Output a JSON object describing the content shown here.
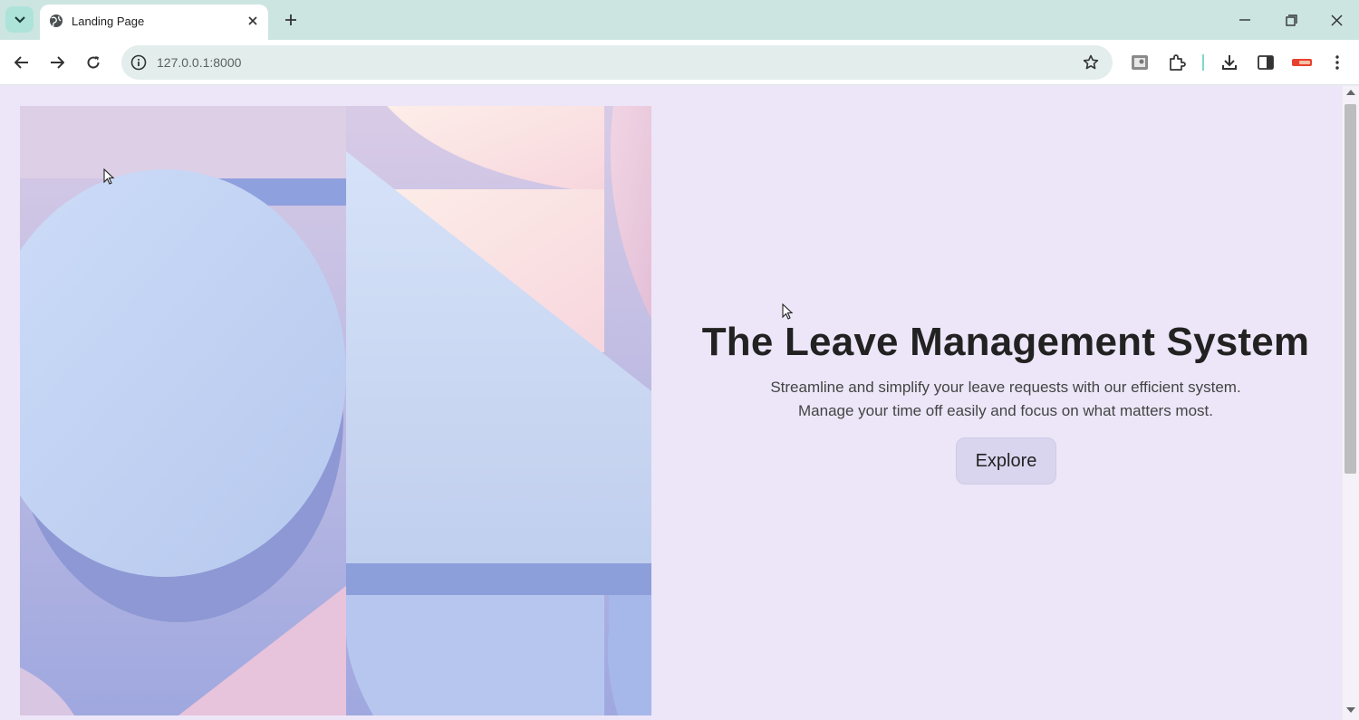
{
  "browser": {
    "tab": {
      "title": "Landing Page"
    },
    "address_bar": {
      "url": "127.0.0.1:8000"
    }
  },
  "page": {
    "title": "The Leave Management System",
    "description_line1": "Streamline and simplify your leave requests with our efficient system.",
    "description_line2": "Manage your time off easily and focus on what matters most.",
    "cta_label": "Explore"
  },
  "icons": {
    "tab_search": "chevron-down-icon",
    "favicon": "globe-icon",
    "tab_close": "close-icon",
    "new_tab": "plus-icon",
    "minimize": "minimize-icon",
    "restore": "restore-icon",
    "close_window": "close-icon",
    "back": "arrow-left-icon",
    "forward": "arrow-right-icon",
    "reload": "reload-icon",
    "site_info": "info-icon",
    "bookmark": "star-icon",
    "profile_ext": "image-icon",
    "extensions": "puzzle-icon",
    "downloads": "download-icon",
    "side_panel": "side-panel-icon",
    "profile": "profile-icon",
    "menu": "kebab-menu-icon"
  },
  "colors": {
    "page_background": "#ede6f8",
    "tabstrip": "#cce5e1",
    "button_background": "#d9d5ef"
  }
}
